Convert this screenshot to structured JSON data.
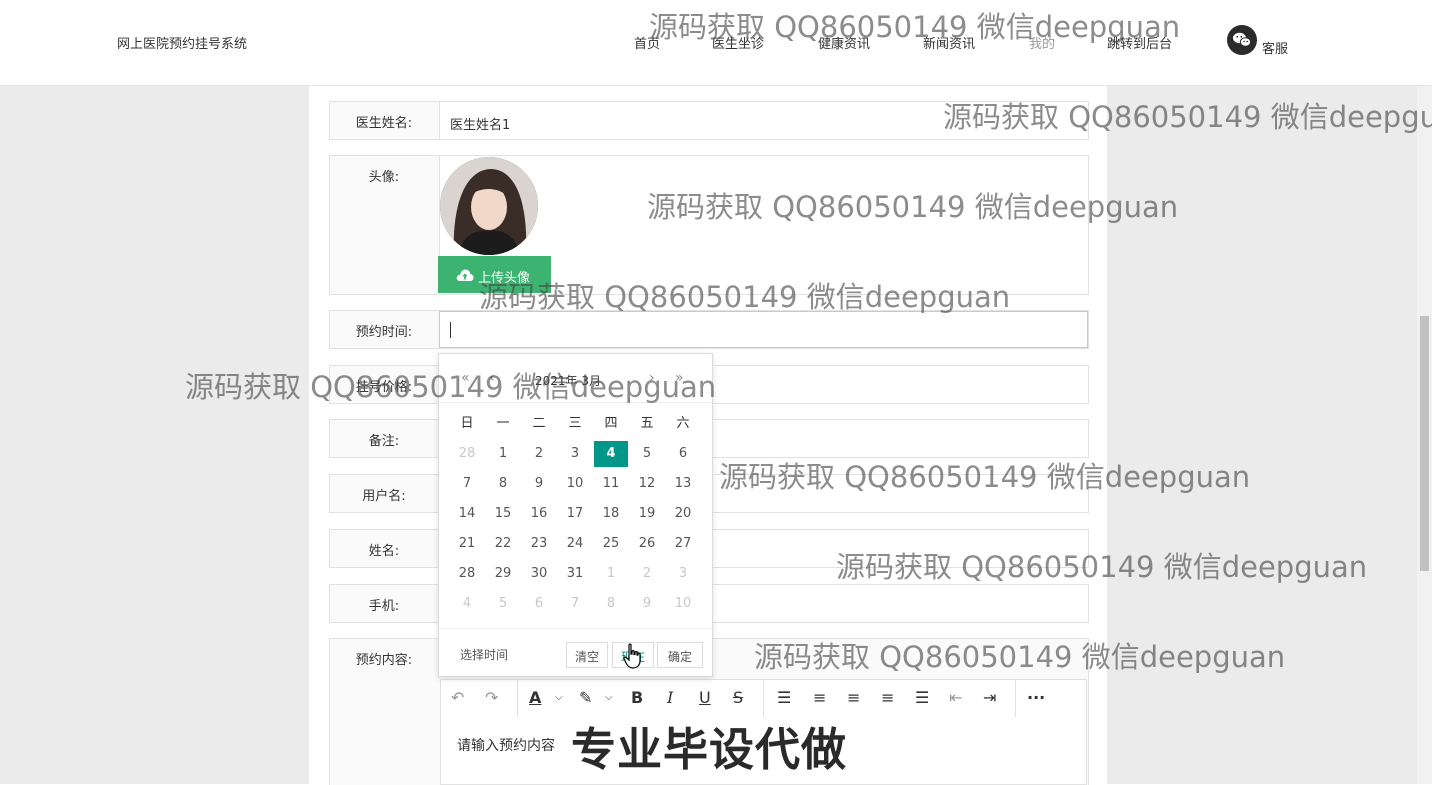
{
  "header": {
    "brand": "网上医院预约挂号系统",
    "nav": [
      "首页",
      "医生坐诊",
      "健康资讯",
      "新闻资讯",
      "我的",
      "跳转到后台"
    ],
    "kefu": "客服"
  },
  "form": {
    "doctor_name": {
      "label": "医生姓名:",
      "value": "医生姓名1"
    },
    "avatar": {
      "label": "头像:",
      "upload_label": "上传头像"
    },
    "appointment_time": {
      "label": "预约时间:",
      "value": ""
    },
    "price": {
      "label": "挂号价格:"
    },
    "remark": {
      "label": "备注:"
    },
    "username": {
      "label": "用户名:"
    },
    "name": {
      "label": "姓名:"
    },
    "phone": {
      "label": "手机:"
    },
    "content": {
      "label": "预约内容:",
      "placeholder": "请输入预约内容"
    }
  },
  "datepicker": {
    "year_month": "2021年 3月",
    "weekdays": [
      "日",
      "一",
      "二",
      "三",
      "四",
      "五",
      "六"
    ],
    "days": [
      [
        28,
        1,
        2,
        3,
        4,
        5,
        6
      ],
      [
        7,
        8,
        9,
        10,
        11,
        12,
        13
      ],
      [
        14,
        15,
        16,
        17,
        18,
        19,
        20
      ],
      [
        21,
        22,
        23,
        24,
        25,
        26,
        27
      ],
      [
        28,
        29,
        30,
        31,
        1,
        2,
        3
      ],
      [
        4,
        5,
        6,
        7,
        8,
        9,
        10
      ]
    ],
    "selected_day": 4,
    "footer": {
      "select_time": "选择时间",
      "clear": "清空",
      "now": "现在",
      "confirm": "确定"
    }
  },
  "watermarks": {
    "text": "源码获取 QQ86050149 微信deepguan",
    "big": "专业毕设代做"
  },
  "colors": {
    "accent": "#009688",
    "upload": "#3cb371"
  }
}
